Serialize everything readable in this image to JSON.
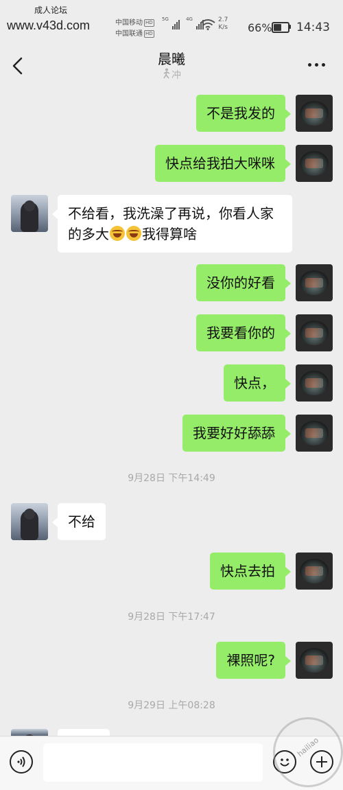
{
  "status_bar": {
    "watermark_label": "成人论坛",
    "watermark_url": "www.v43d.com",
    "carrier_1": "中国移动",
    "carrier_2": "中国联通",
    "hd_badge": "HD",
    "network_1": "5G",
    "network_2": "4G",
    "speed_value": "2.7",
    "speed_unit": "K/s",
    "battery_percent": "66%",
    "battery_level": 0.66,
    "time": "14:43"
  },
  "header": {
    "title": "晨曦",
    "subtitle": "冲"
  },
  "messages": [
    {
      "sender": "self",
      "text": "不是我发的"
    },
    {
      "sender": "self",
      "text": "快点给我拍大咪咪"
    },
    {
      "sender": "other",
      "text_before": "不给看，我洗澡了再说，你看人家的多大",
      "emoji": "joy-tears-emoji",
      "text_after": "我得算啥"
    },
    {
      "sender": "self",
      "text": "没你的好看"
    },
    {
      "sender": "self",
      "text": "我要看你的"
    },
    {
      "sender": "self",
      "text": "快点，"
    },
    {
      "sender": "self",
      "text": "我要好好舔舔"
    },
    {
      "type": "timestamp",
      "text": "9月28日 下午14:49"
    },
    {
      "sender": "other",
      "text": "不给"
    },
    {
      "sender": "self",
      "text": "快点去拍"
    },
    {
      "type": "timestamp",
      "text": "9月28日 下午17:47"
    },
    {
      "sender": "self",
      "text": "裸照呢?"
    },
    {
      "type": "timestamp",
      "text": "9月29日 上午08:28"
    }
  ],
  "input_bar": {
    "value": "",
    "icons": [
      "voice-icon",
      "emoji-icon",
      "plus-icon"
    ]
  },
  "watermark_stamp": "hailiao",
  "colors": {
    "self_bubble": "#95ec69",
    "other_bubble": "#ffffff",
    "background": "#ededed"
  }
}
